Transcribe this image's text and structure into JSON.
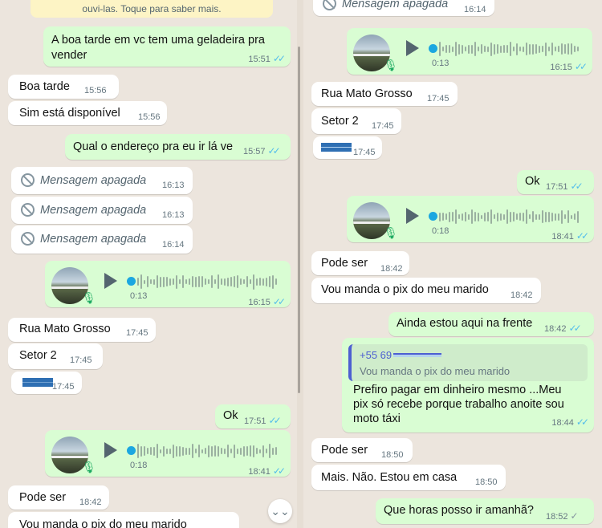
{
  "left": {
    "banner": "ouvi-las. Toque para saber mais.",
    "messages": [
      {
        "text_l1": "A boa tarde em vc tem uma geladeira pra",
        "text_l2": "vender",
        "time": "15:51"
      },
      {
        "text": "Boa tarde",
        "time": "15:56"
      },
      {
        "text": "Sim está disponível",
        "time": "15:56"
      },
      {
        "text": "Qual o endereço pra eu ir lá ve",
        "time": "15:57"
      },
      {
        "text": "Mensagem apagada",
        "time": "16:13"
      },
      {
        "text": "Mensagem apagada",
        "time": "16:13"
      },
      {
        "text": "Mensagem apagada",
        "time": "16:14"
      },
      {
        "duration": "0:13",
        "time": "16:15"
      },
      {
        "text": "Rua Mato Grosso",
        "time": "17:45"
      },
      {
        "text": "Setor 2",
        "time": "17:45"
      },
      {
        "time": "17:45"
      },
      {
        "text": "Ok",
        "time": "17:51"
      },
      {
        "duration": "0:18",
        "time": "18:41"
      },
      {
        "text": "Pode ser",
        "time": "18:42"
      },
      {
        "text": "Vou manda o pix do meu marido"
      }
    ]
  },
  "right": {
    "messages": [
      {
        "text": "Mensagem apagada",
        "time": "16:14"
      },
      {
        "duration": "0:13",
        "time": "16:15"
      },
      {
        "text": "Rua Mato Grosso",
        "time": "17:45"
      },
      {
        "text": "Setor 2",
        "time": "17:45"
      },
      {
        "time": "17:45"
      },
      {
        "text": "Ok",
        "time": "17:51"
      },
      {
        "duration": "0:18",
        "time": "18:41"
      },
      {
        "text": "Pode ser",
        "time": "18:42"
      },
      {
        "text": "Vou manda o pix do meu marido",
        "time": "18:42"
      },
      {
        "text": "Ainda estou aqui na frente",
        "time": "18:42"
      },
      {
        "quote_name": "+55 69",
        "quote_text": "Vou manda o pix do meu marido",
        "l1": "Prefiro pagar em dinheiro mesmo ...Meu",
        "l2": "pix só recebe porque trabalho anoite  sou",
        "l3": "moto táxi",
        "time": "18:44"
      },
      {
        "text": "Pode ser",
        "time": "18:50"
      },
      {
        "text": "Mais. Não. Estou em casa",
        "time": "18:50"
      },
      {
        "text": "Que horas posso ir amanhã?",
        "time": "18:52"
      }
    ]
  },
  "icons": {
    "read_tick": "✓✓",
    "sent_tick": "✓",
    "scroll": "⌄⌄"
  },
  "colors": {
    "incoming": "#ffffff",
    "outgoing": "#d9fdd3",
    "read_tick": "#53bdeb",
    "background": "#ece5dd"
  }
}
